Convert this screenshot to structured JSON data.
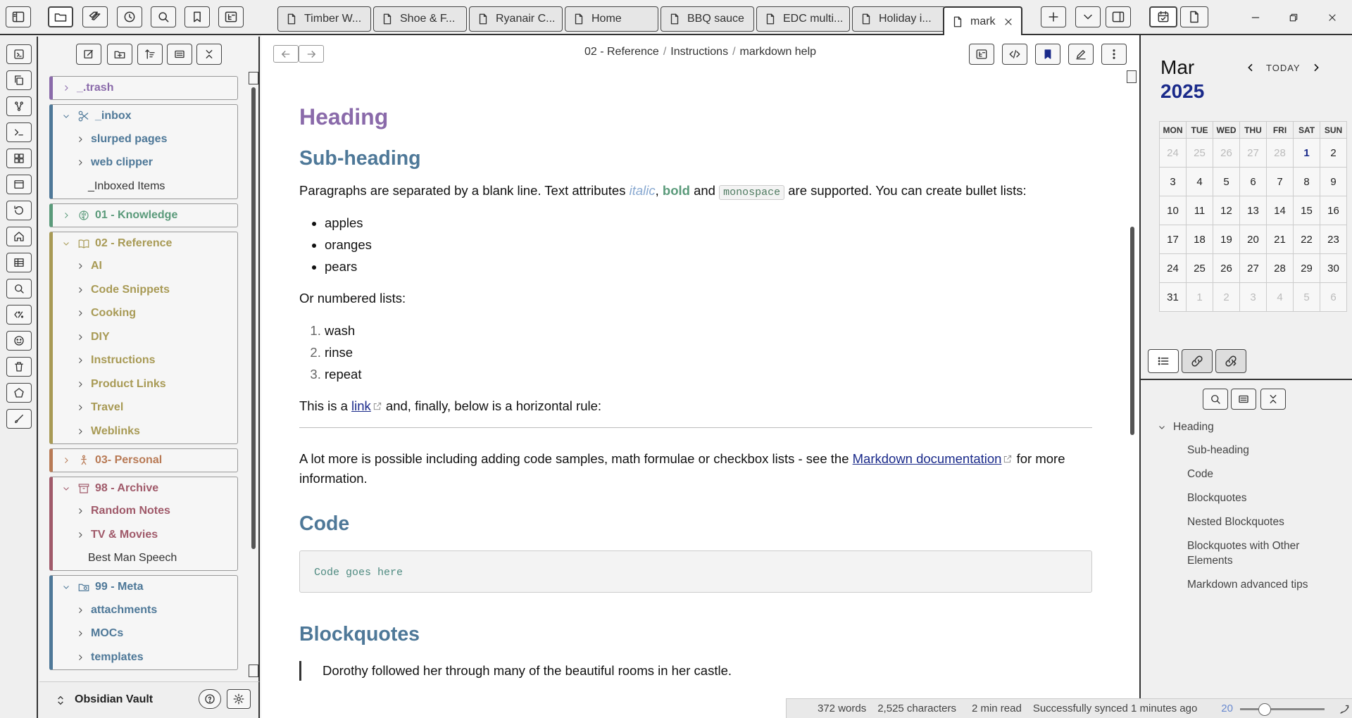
{
  "tabs": [
    {
      "label": "Timber W..."
    },
    {
      "label": "Shoe & F..."
    },
    {
      "label": "Ryanair C..."
    },
    {
      "label": "Home"
    },
    {
      "label": "BBQ sauce"
    },
    {
      "label": "EDC multi..."
    },
    {
      "label": "Holiday i..."
    },
    {
      "label": "mark..."
    }
  ],
  "icons": {
    "sidebar_toggle": "sidebar-left-icon",
    "files": "folder-icon",
    "tags": "tags-icon",
    "recent": "clock-icon",
    "search": "search-icon",
    "bookmarks": "bookmark-icon",
    "tree": "tree-icon"
  },
  "sidebar": {
    "groups": [
      {
        "label": "_.trash",
        "color": "#8a6aaa",
        "expanded": false,
        "children": []
      },
      {
        "label": "_inbox",
        "color": "#4e7898",
        "expanded": true,
        "children": [
          {
            "label": "slurped pages",
            "type": "folder"
          },
          {
            "label": "web clipper",
            "type": "folder"
          },
          {
            "label": "_Inboxed Items",
            "type": "file"
          }
        ]
      },
      {
        "label": "01 - Knowledge",
        "color": "#5a9a7a",
        "expanded": false,
        "children": []
      },
      {
        "label": "02 - Reference",
        "color": "#a89a55",
        "expanded": true,
        "children": [
          {
            "label": "AI",
            "type": "folder"
          },
          {
            "label": "Code Snippets",
            "type": "folder"
          },
          {
            "label": "Cooking",
            "type": "folder"
          },
          {
            "label": "DIY",
            "type": "folder"
          },
          {
            "label": "Instructions",
            "type": "folder"
          },
          {
            "label": "Product Links",
            "type": "folder"
          },
          {
            "label": "Travel",
            "type": "folder"
          },
          {
            "label": "Weblinks",
            "type": "folder"
          }
        ]
      },
      {
        "label": "03- Personal",
        "color": "#b87a55",
        "expanded": false,
        "children": []
      },
      {
        "label": "98 - Archive",
        "color": "#a05a6a",
        "expanded": true,
        "children": [
          {
            "label": "Random Notes",
            "type": "folder"
          },
          {
            "label": "TV & Movies",
            "type": "folder"
          },
          {
            "label": "Best Man Speech",
            "type": "file"
          }
        ]
      },
      {
        "label": "99 - Meta",
        "color": "#4e7898",
        "expanded": true,
        "children": [
          {
            "label": "attachments",
            "type": "folder"
          },
          {
            "label": "MOCs",
            "type": "folder"
          },
          {
            "label": "templates",
            "type": "folder"
          }
        ]
      }
    ]
  },
  "vault": {
    "name": "Obsidian Vault"
  },
  "breadcrumb": [
    "02 - Reference",
    "Instructions",
    "markdown help"
  ],
  "doc": {
    "h1": "Heading",
    "h2_sub": "Sub-heading",
    "p1_a": "Paragraphs are separated by a blank line. Text attributes ",
    "p1_italic": "italic",
    "p1_comma": ", ",
    "p1_bold": "bold",
    "p1_and": " and ",
    "p1_mono": "monospace",
    "p1_b": " are supported. You can create bullet lists:",
    "bullets": [
      "apples",
      "oranges",
      "pears"
    ],
    "p_numbered": "Or numbered lists:",
    "numbered": [
      "wash",
      "rinse",
      "repeat"
    ],
    "p_link_a": "This is a ",
    "p_link_text": "link",
    "p_link_b": " and, finally, below is a horizontal rule:",
    "p_more_a": "A lot more is possible including adding code samples, math formulae or checkbox lists - see the ",
    "p_more_link": "Markdown documentation",
    "p_more_b": " for more information.",
    "h2_code": "Code",
    "code": "Code goes here",
    "h2_bq": "Blockquotes",
    "bq_text": "Dorothy followed her through many of the beautiful rooms in her castle."
  },
  "status": {
    "words": "372 words",
    "chars": "2,525 characters",
    "read": "2 min read",
    "sync": "Successfully synced 1 minutes ago",
    "zoom": "20"
  },
  "calendar": {
    "month": "Mar",
    "year": "2025",
    "today_label": "TODAY",
    "weekdays": [
      "MON",
      "TUE",
      "WED",
      "THU",
      "FRI",
      "SAT",
      "SUN"
    ],
    "weeks": [
      [
        "24",
        "25",
        "26",
        "27",
        "28",
        "1",
        "2"
      ],
      [
        "3",
        "4",
        "5",
        "6",
        "7",
        "8",
        "9"
      ],
      [
        "10",
        "11",
        "12",
        "13",
        "14",
        "15",
        "16"
      ],
      [
        "17",
        "18",
        "19",
        "20",
        "21",
        "22",
        "23"
      ],
      [
        "24",
        "25",
        "26",
        "27",
        "28",
        "29",
        "30"
      ],
      [
        "31",
        "1",
        "2",
        "3",
        "4",
        "5",
        "6"
      ]
    ]
  },
  "outline": {
    "root": "Heading",
    "items": [
      "Sub-heading",
      "Code",
      "Blockquotes",
      "Nested Blockquotes",
      "Blockquotes with Other Elements",
      "Markdown advanced tips"
    ]
  }
}
